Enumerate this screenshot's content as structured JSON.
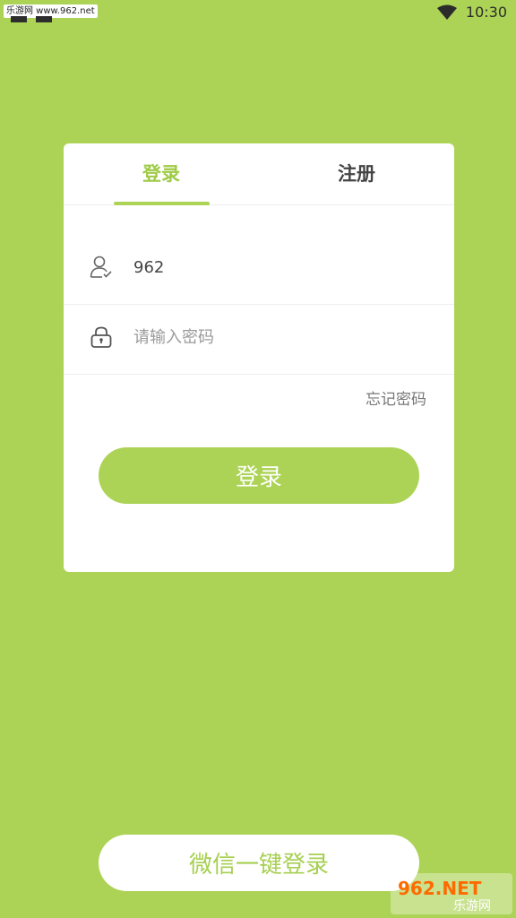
{
  "status_bar": {
    "watermark_text": "乐游网 www.962.net",
    "time": "10:30",
    "wifi_icon": "wifi-icon"
  },
  "tabs": [
    {
      "label": "登录",
      "active": true
    },
    {
      "label": "注册",
      "active": false
    }
  ],
  "form": {
    "username": {
      "value": "962",
      "icon": "user-icon"
    },
    "password": {
      "placeholder": "请输入密码",
      "icon": "lock-icon"
    },
    "forgot_label": "忘记密码",
    "login_label": "登录"
  },
  "wechat_login_label": "微信一键登录",
  "watermark_logo": {
    "line1": "962.NET",
    "line2": "乐游网"
  },
  "colors": {
    "background": "#acd355",
    "accent": "#acd355",
    "card": "#ffffff",
    "tab_inactive": "#444444",
    "placeholder": "#9a9a9a"
  }
}
